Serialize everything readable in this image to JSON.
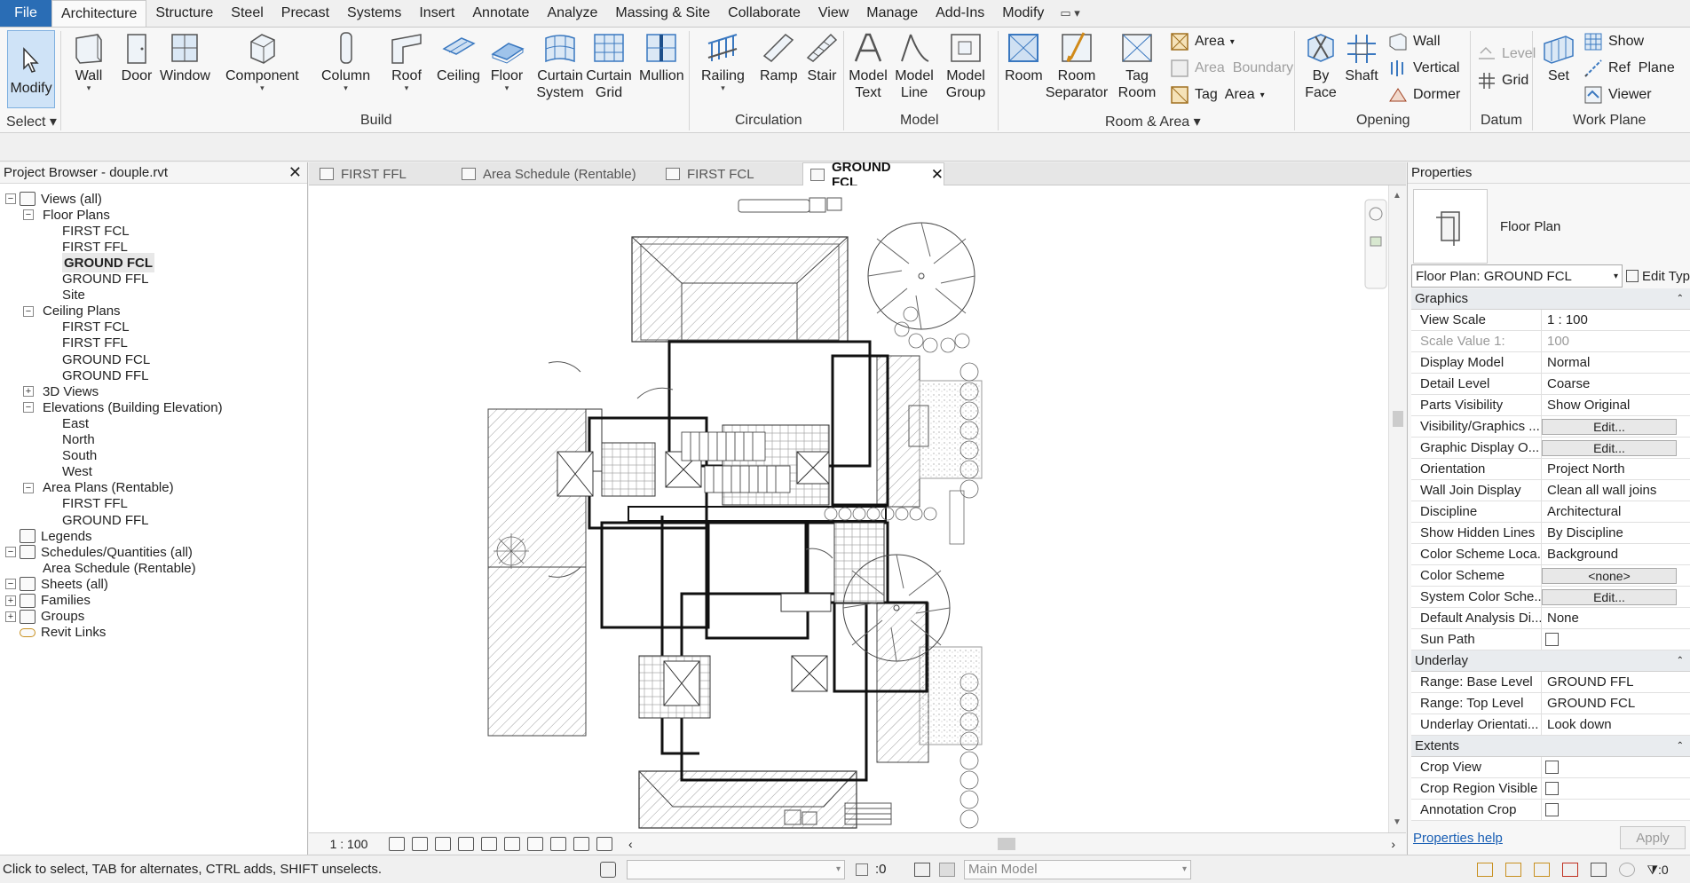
{
  "menubar": {
    "file": "File",
    "tabs": [
      "Architecture",
      "Structure",
      "Steel",
      "Precast",
      "Systems",
      "Insert",
      "Annotate",
      "Analyze",
      "Massing & Site",
      "Collaborate",
      "View",
      "Manage",
      "Add-Ins",
      "Modify"
    ],
    "active": "Architecture"
  },
  "ribbon": {
    "select_label": "Select",
    "modify": "Modify",
    "build": {
      "label": "Build",
      "buttons": [
        "Wall",
        "Door",
        "Window",
        "Component",
        "Column",
        "Roof",
        "Ceiling",
        "Floor",
        "Curtain\nSystem",
        "Curtain\nGrid",
        "Mullion"
      ]
    },
    "circulation": {
      "label": "Circulation",
      "buttons": [
        "Railing",
        "Ramp",
        "Stair"
      ]
    },
    "model": {
      "label": "Model",
      "buttons": [
        "Model\nText",
        "Model\nLine",
        "Model\nGroup"
      ]
    },
    "room_area": {
      "label": "Room & Area",
      "buttons": [
        "Room",
        "Room\nSeparator",
        "Tag\nRoom"
      ],
      "small": [
        "Area",
        "Area  Boundary",
        "Tag  Area"
      ]
    },
    "opening": {
      "label": "Opening",
      "buttons": [
        "By\nFace",
        "Shaft"
      ],
      "small": [
        "Wall",
        "Vertical",
        "Dormer"
      ]
    },
    "datum": {
      "label": "Datum",
      "small": [
        "Level",
        "Grid"
      ]
    },
    "work_plane": {
      "label": "Work Plane",
      "buttons": [
        "Set"
      ],
      "small": [
        "Show",
        "Ref  Plane",
        "Viewer"
      ]
    }
  },
  "browser": {
    "title": "Project Browser - douple.rvt",
    "items": [
      {
        "label": "Views (all)",
        "level": 0
      },
      {
        "label": "Floor Plans",
        "level": 1
      },
      {
        "label": "FIRST FCL",
        "level": 2
      },
      {
        "label": "FIRST FFL",
        "level": 2
      },
      {
        "label": "GROUND FCL",
        "level": 2,
        "active": true
      },
      {
        "label": "GROUND FFL",
        "level": 2
      },
      {
        "label": "Site",
        "level": 2
      },
      {
        "label": "Ceiling Plans",
        "level": 1
      },
      {
        "label": "FIRST FCL",
        "level": 2
      },
      {
        "label": "FIRST FFL",
        "level": 2
      },
      {
        "label": "GROUND FCL",
        "level": 2
      },
      {
        "label": "GROUND FFL",
        "level": 2
      },
      {
        "label": "3D Views",
        "level": 1
      },
      {
        "label": "Elevations (Building Elevation)",
        "level": 1
      },
      {
        "label": "East",
        "level": 2
      },
      {
        "label": "North",
        "level": 2
      },
      {
        "label": "South",
        "level": 2
      },
      {
        "label": "West",
        "level": 2
      },
      {
        "label": "Area Plans (Rentable)",
        "level": 1
      },
      {
        "label": "FIRST FFL",
        "level": 2
      },
      {
        "label": "GROUND FFL",
        "level": 2
      },
      {
        "label": "Legends",
        "level": 0
      },
      {
        "label": "Schedules/Quantities (all)",
        "level": 0
      },
      {
        "label": "Area Schedule (Rentable)",
        "level": 1
      },
      {
        "label": "Sheets (all)",
        "level": 0
      },
      {
        "label": "Families",
        "level": 0
      },
      {
        "label": "Groups",
        "level": 0
      },
      {
        "label": "Revit Links",
        "level": 0
      }
    ]
  },
  "doctabs": [
    "FIRST FFL",
    "Area Schedule (Rentable)",
    "FIRST FCL",
    "GROUND FCL"
  ],
  "view_control": {
    "scale": "1 : 100"
  },
  "properties": {
    "title": "Properties",
    "type_name": "Floor Plan",
    "selector": "Floor Plan: GROUND FCL",
    "edit_type": "Edit Type",
    "groups": [
      {
        "name": "Graphics",
        "rows": [
          {
            "k": "View Scale",
            "v": "1 : 100"
          },
          {
            "k": "Scale Value    1:",
            "v": "100",
            "disabled": true
          },
          {
            "k": "Display Model",
            "v": "Normal"
          },
          {
            "k": "Detail Level",
            "v": "Coarse"
          },
          {
            "k": "Parts Visibility",
            "v": "Show Original"
          },
          {
            "k": "Visibility/Graphics ...",
            "v": "Edit...",
            "button": true
          },
          {
            "k": "Graphic Display O...",
            "v": "Edit...",
            "button": true
          },
          {
            "k": "Orientation",
            "v": "Project North"
          },
          {
            "k": "Wall Join Display",
            "v": "Clean all wall joins"
          },
          {
            "k": "Discipline",
            "v": "Architectural"
          },
          {
            "k": "Show Hidden Lines",
            "v": "By Discipline"
          },
          {
            "k": "Color Scheme Loca...",
            "v": "Background"
          },
          {
            "k": "Color Scheme",
            "v": "<none>",
            "button": true
          },
          {
            "k": "System Color Sche...",
            "v": "Edit...",
            "button": true
          },
          {
            "k": "Default Analysis Di...",
            "v": "None"
          },
          {
            "k": "Sun Path",
            "v": "",
            "checkbox": true
          }
        ]
      },
      {
        "name": "Underlay",
        "rows": [
          {
            "k": "Range: Base Level",
            "v": "GROUND FFL"
          },
          {
            "k": "Range: Top Level",
            "v": "GROUND FCL"
          },
          {
            "k": "Underlay Orientati...",
            "v": "Look down"
          }
        ]
      },
      {
        "name": "Extents",
        "rows": [
          {
            "k": "Crop View",
            "v": "",
            "checkbox": true
          },
          {
            "k": "Crop Region Visible",
            "v": "",
            "checkbox": true
          },
          {
            "k": "Annotation Crop",
            "v": "",
            "checkbox": true
          }
        ]
      }
    ],
    "help": "Properties help",
    "apply": "Apply"
  },
  "status": {
    "message": "Click to select, TAB for alternates, CTRL adds, SHIFT unselects.",
    "filter_count": ":0",
    "model": "Main Model",
    "filter_total": ":0"
  }
}
